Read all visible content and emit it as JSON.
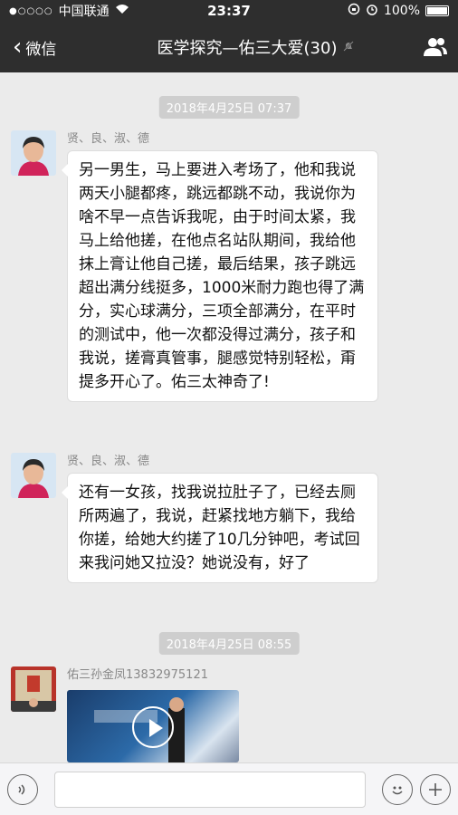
{
  "status": {
    "signal": "●○○○○",
    "carrier": "中国联通",
    "time": "23:37",
    "battery": "100%"
  },
  "nav": {
    "back_label": "微信",
    "title": "医学探究—佑三大爱(30)"
  },
  "chat": {
    "timestamps": [
      "2018年4月25日 07:37",
      "2018年4月25日 08:55"
    ],
    "messages": [
      {
        "sender": "贤、良、淑、德",
        "text": "另一男生，马上要进入考场了，他和我说两天小腿都疼，跳远都跳不动，我说你为啥不早一点告诉我呢，由于时间太紧，我马上给他搓，在他点名站队期间，我给他抹上膏让他自己搓，最后结果，孩子跳远超出满分线挺多，1000米耐力跑也得了满分，实心球满分，三项全部满分，在平时的测试中，他一次都没得过满分，孩子和我说，搓膏真管事，腿感觉特别轻松，甭提多开心了。佑三太神奇了!"
      },
      {
        "sender": "贤、良、淑、德",
        "text": "还有一女孩，找我说拉肚子了，已经去厕所两遍了，我说，赶紧找地方躺下，我给你搓，给她大约搓了10几分钟吧，考试回来我问她又拉没？她说没有，好了"
      },
      {
        "sender": "佑三孙金凤13832975121"
      }
    ]
  },
  "colors": {
    "header_bg": "#2e2e2e",
    "chat_bg": "#ebebeb",
    "bubble_bg": "#ffffff"
  },
  "icons": {
    "back": "chevron-left-icon",
    "mute": "mute-bell-icon",
    "group": "group-people-icon",
    "voice": "voice-icon",
    "emoji": "emoji-icon",
    "plus": "plus-icon",
    "play": "play-icon"
  }
}
